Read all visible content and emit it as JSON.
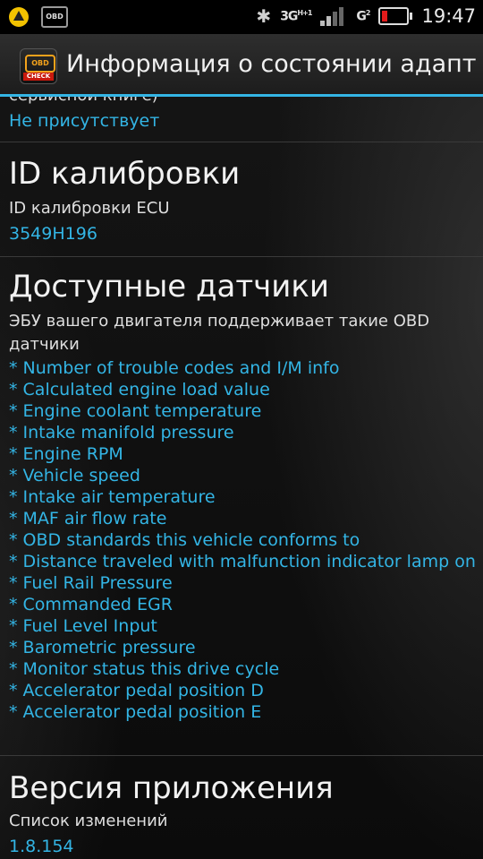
{
  "status_bar": {
    "obd_notification": "OBD",
    "network": "3G",
    "network_sub": "H+1",
    "network2": "G",
    "sim2": "2",
    "time": "19:47"
  },
  "action_bar": {
    "app_icon_top": "OBD",
    "app_icon_bottom": "CHECK",
    "title": "Информация о состоянии адаптера"
  },
  "sections": {
    "prev": {
      "cut_text": "сервисной книге)",
      "value": "Не присутствует"
    },
    "calibration": {
      "title": "ID калибровки",
      "subtitle": "ID калибровки ECU",
      "value": "3549H196"
    },
    "sensors": {
      "title": "Доступные датчики",
      "subtitle": "ЭБУ вашего двигателя поддерживает такие OBD датчики",
      "items": [
        "* Number of trouble codes and I/M info",
        "* Calculated engine load value",
        "* Engine coolant temperature",
        "* Intake manifold pressure",
        "* Engine RPM",
        "* Vehicle speed",
        "* Intake air temperature",
        "* MAF air flow rate",
        "* OBD standards this vehicle conforms to",
        "* Distance traveled with malfunction indicator lamp on",
        "* Fuel Rail Pressure",
        "* Commanded EGR",
        "* Fuel Level Input",
        "* Barometric pressure",
        "* Monitor status this drive cycle",
        "* Accelerator pedal position D",
        "* Accelerator pedal position E"
      ]
    },
    "version": {
      "title": "Версия приложения",
      "subtitle": "Список изменений",
      "value": "1.8.154"
    }
  },
  "colors": {
    "accent": "#33b5e5",
    "battery_low": "#e21b1b"
  }
}
